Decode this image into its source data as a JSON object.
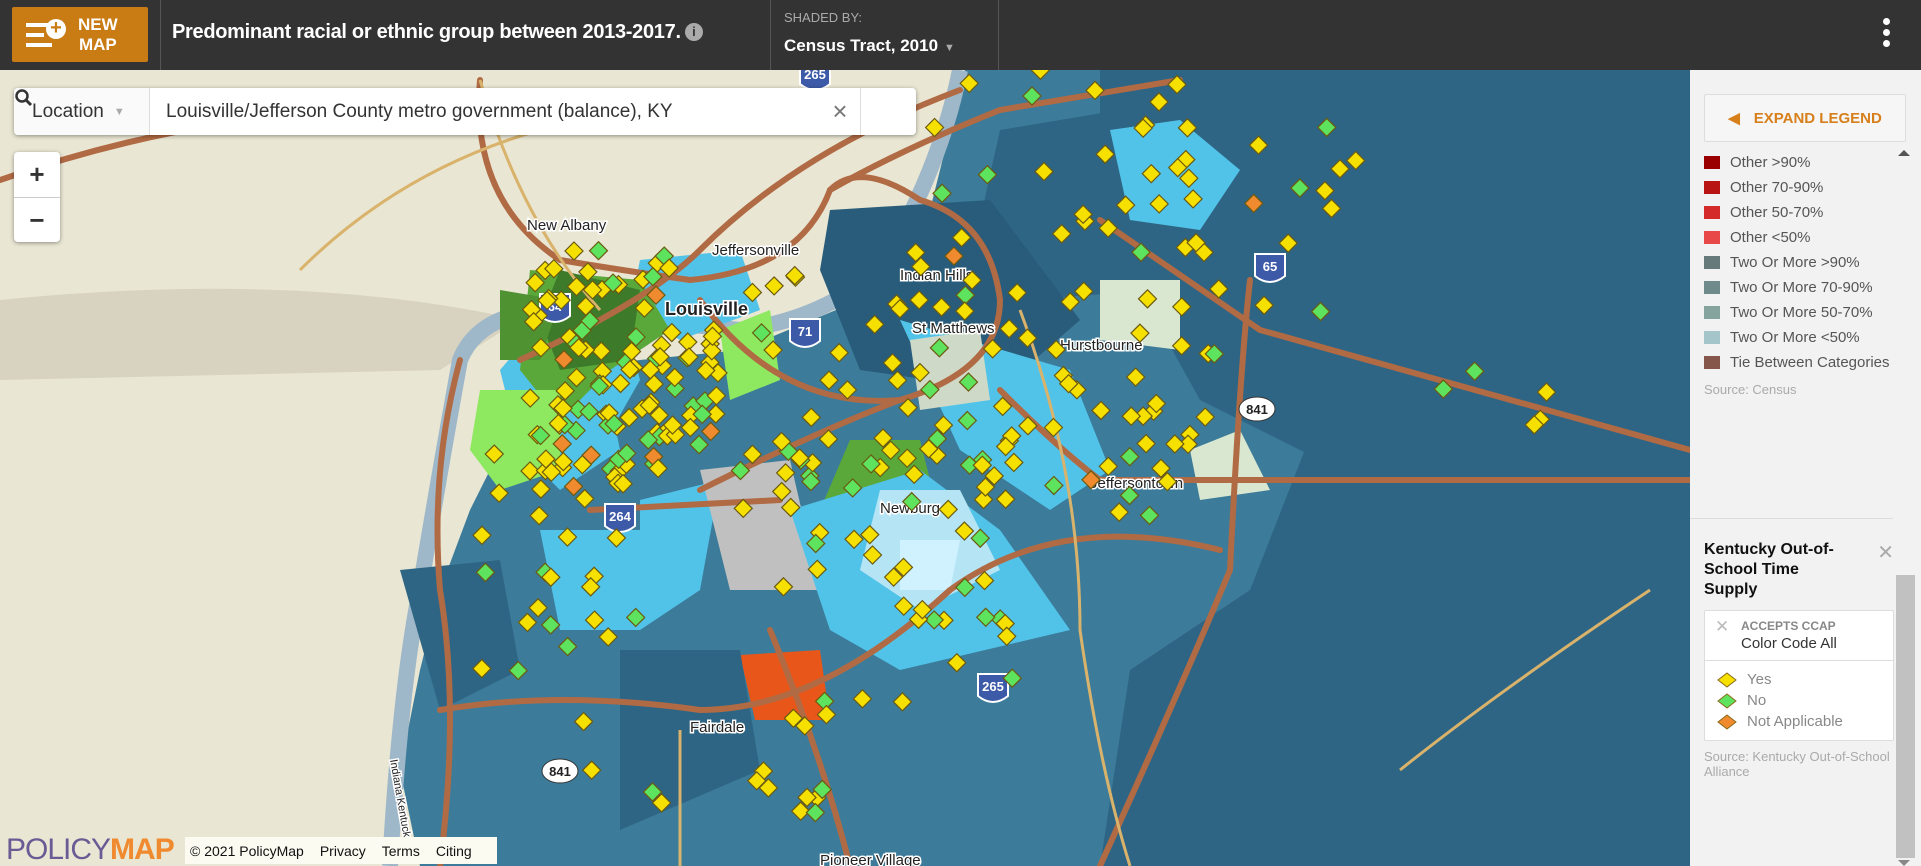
{
  "header": {
    "new_map_label_1": "NEW",
    "new_map_label_2": "MAP",
    "title": "Predominant racial or ethnic group between 2013-2017.",
    "info_icon": "i",
    "shaded_by_label": "SHADED BY:",
    "shaded_by_value": "Census Tract, 2010"
  },
  "search": {
    "location_select": "Location",
    "value": "Louisville/Jefferson County metro government (balance), KY"
  },
  "zoom": {
    "in": "+",
    "out": "−"
  },
  "map_labels": {
    "new_albany": "New Albany",
    "jeffersonville": "Jeffersonville",
    "louisville": "Louisville",
    "indian_hills": "Indian Hills",
    "st_matthews": "St Matthews",
    "hurstbourne": "Hurstbourne",
    "jeffersontown": "Jeffersontown",
    "newburg": "Newburg",
    "fairdale": "Fairdale",
    "pioneer_village": "Pioneer Village",
    "state_line": "Indiana Kentucky"
  },
  "shields": {
    "i64": "64",
    "i71": "71",
    "i265a": "265",
    "i265b": "265",
    "i264": "264",
    "i65": "65",
    "r841a": "841",
    "r841b": "841"
  },
  "footer": {
    "logo_a": "POLICY",
    "logo_b": "MAP",
    "copyright": "© 2021 PolicyMap",
    "privacy": "Privacy",
    "terms": "Terms",
    "citing": "Citing"
  },
  "legend": {
    "expand": "EXPAND LEGEND",
    "items": [
      {
        "label": "Other >90%",
        "color": "#9b0000"
      },
      {
        "label": "Other 70-90%",
        "color": "#b81414"
      },
      {
        "label": "Other 50-70%",
        "color": "#d42a2a"
      },
      {
        "label": "Other <50%",
        "color": "#e84848"
      },
      {
        "label": "Two Or More >90%",
        "color": "#667a7c"
      },
      {
        "label": "Two Or More 70-90%",
        "color": "#6e8a8a"
      },
      {
        "label": "Two Or More 50-70%",
        "color": "#86a49e"
      },
      {
        "label": "Two Or More <50%",
        "color": "#a4c6ca"
      },
      {
        "label": "Tie Between Categories",
        "color": "#85564a"
      }
    ],
    "source": "Source: Census",
    "layer": {
      "title": "Kentucky Out-of-School Time Supply",
      "filter_label": "ACCEPTS CCAP",
      "filter_value": "Color Code All",
      "points": [
        {
          "label": "Yes",
          "color": "#f5e000"
        },
        {
          "label": "No",
          "color": "#5ee35e"
        },
        {
          "label": "Not Applicable",
          "color": "#f08a2e"
        }
      ],
      "source": "Source: Kentucky Out-of-School Alliance"
    }
  }
}
